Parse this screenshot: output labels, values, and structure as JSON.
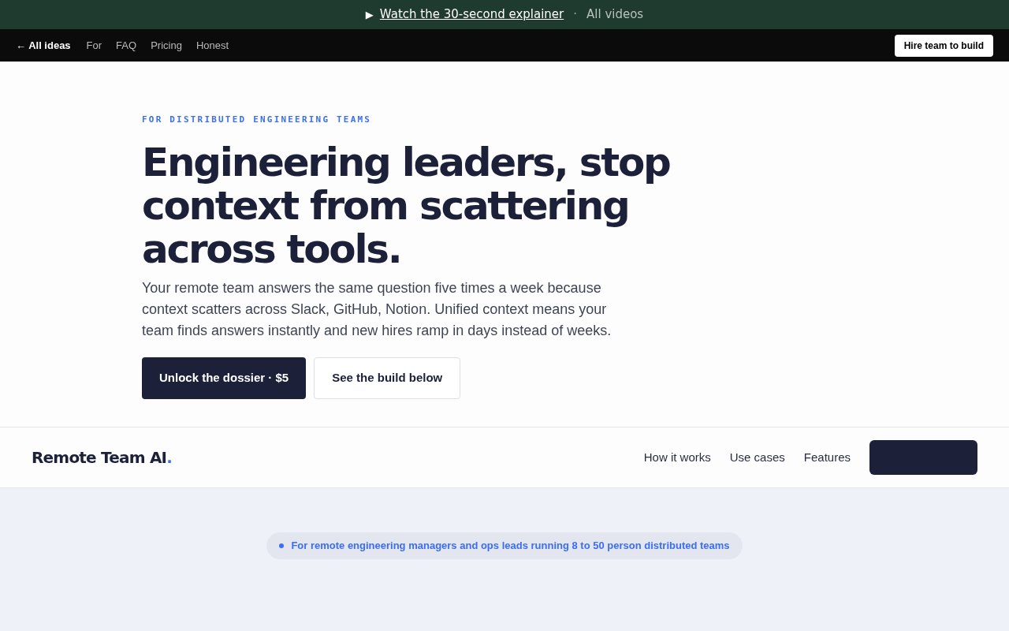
{
  "announcement": {
    "icon": "▶",
    "link": "Watch the 30-second explainer",
    "separator": "·",
    "secondary": "All videos"
  },
  "topnav": {
    "back": "← All ideas",
    "links": [
      "For",
      "FAQ",
      "Pricing",
      "Honest"
    ],
    "cta": "Hire team to build"
  },
  "hero": {
    "eyebrow": "FOR DISTRIBUTED ENGINEERING TEAMS",
    "headline": "Engineering leaders, stop context from scattering across tools.",
    "body": "Your remote team answers the same question five times a week because context scatters across Slack, GitHub, Notion. Unified context means your team finds answers instantly and new hires ramp in days instead of weeks.",
    "primary_button": "Unlock the dossier · $5",
    "secondary_button": "See the build below"
  },
  "site_header": {
    "brand": "Remote Team AI",
    "brand_dot": ".",
    "links": [
      "How it works",
      "Use cases",
      "Features"
    ]
  },
  "audience_pill": "For remote engineering managers and ops leads running 8 to 50 person distributed teams"
}
